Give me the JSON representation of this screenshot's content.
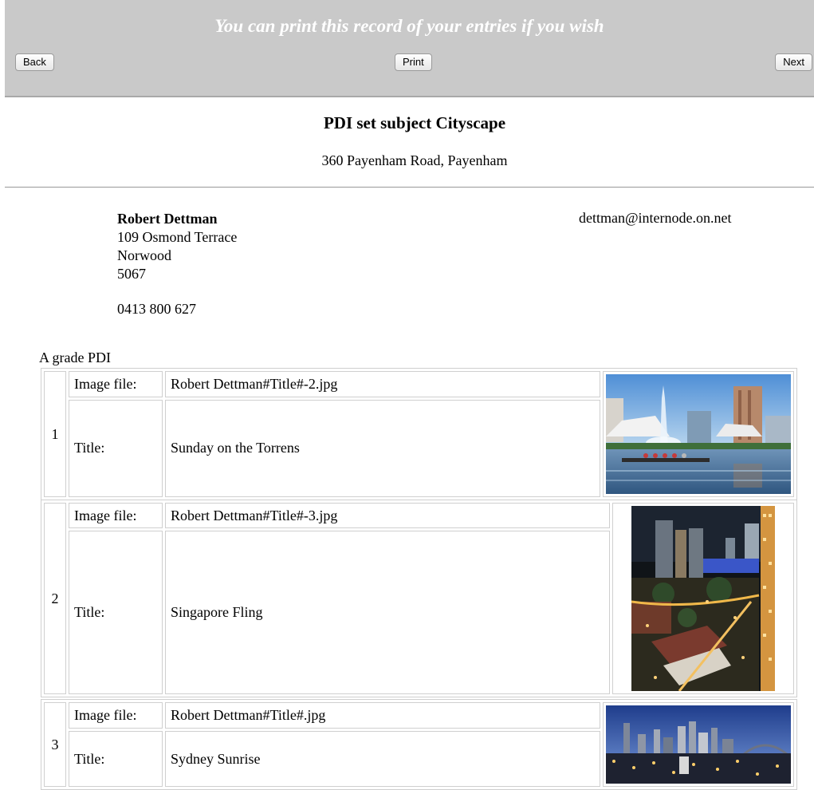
{
  "header": {
    "banner": "You can print this record of your entries if you wish",
    "back_label": "Back",
    "print_label": "Print",
    "next_label": "Next"
  },
  "competition": {
    "title": "PDI set subject Cityscape",
    "venue": "360 Payenham Road, Payenham"
  },
  "entrant": {
    "name": "Robert Dettman",
    "street": "109 Osmond Terrace",
    "suburb": "Norwood",
    "postcode": "5067",
    "phone": "0413 800 627",
    "email": "dettman@internode.on.net"
  },
  "section": {
    "grade": "A grade PDI",
    "file_label": "Image file:",
    "title_label": "Title:"
  },
  "entries": [
    {
      "number": "1",
      "file": "Robert Dettman#Title#-2.jpg",
      "title": "Sunday on the Torrens",
      "thumb": "fountain-river-city-photo"
    },
    {
      "number": "2",
      "file": "Robert Dettman#Title#-3.jpg",
      "title": "Singapore Fling",
      "thumb": "night-city-aerial-photo"
    },
    {
      "number": "3",
      "file": "Robert Dettman#Title#.jpg",
      "title": "Sydney Sunrise",
      "thumb": "city-skyline-dawn-photo"
    }
  ]
}
